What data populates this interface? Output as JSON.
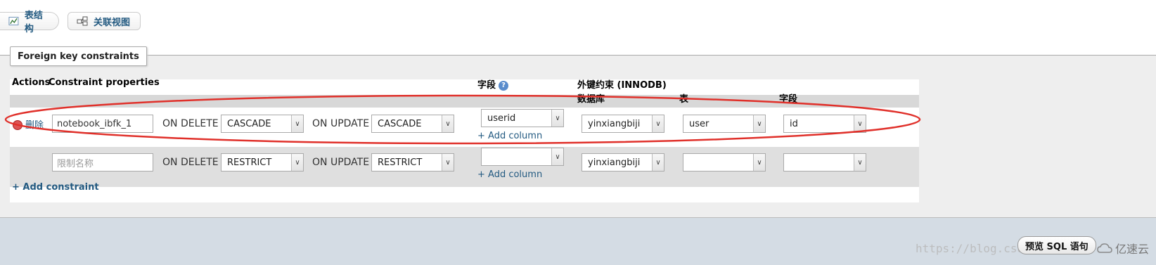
{
  "tabs": [
    {
      "label": "表结构",
      "icon": "structure-icon"
    },
    {
      "label": "关联视图",
      "icon": "relation-view-icon"
    }
  ],
  "fieldset_legend": "Foreign key constraints",
  "headers": {
    "actions": "Actions",
    "constraint_properties": "Constraint properties",
    "field": "字段",
    "foreign_key": "外键约束 (INNODB)",
    "database": "数据库",
    "table": "表",
    "target_field": "字段"
  },
  "rows": [
    {
      "action_label": "删除",
      "constraint_name": "notebook_ibfk_1",
      "on_delete_label": "ON DELETE",
      "on_delete": "CASCADE",
      "on_update_label": "ON UPDATE",
      "on_update": "CASCADE",
      "column": "userid",
      "add_column": "+ Add column",
      "database": "yinxiangbiji",
      "table": "user",
      "field": "id"
    },
    {
      "constraint_placeholder": "限制名称",
      "on_delete_label": "ON DELETE",
      "on_delete": "RESTRICT",
      "on_update_label": "ON UPDATE",
      "on_update": "RESTRICT",
      "column": "",
      "add_column": "+ Add column",
      "database": "yinxiangbiji",
      "table": "",
      "field": ""
    }
  ],
  "add_constraint": "+ Add constraint",
  "preview_sql": "预览 SQL 语句",
  "watermark": "https://blog.csdn.net/",
  "brand": "亿速云",
  "colors": {
    "annotation_ellipse": "#e0302a",
    "link": "#235a81"
  }
}
